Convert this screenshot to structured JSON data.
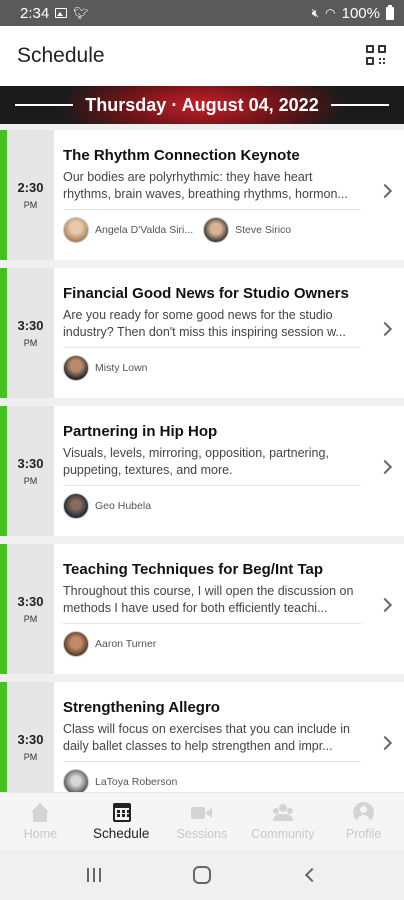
{
  "status_bar": {
    "time": "2:34",
    "battery": "100%"
  },
  "header": {
    "title": "Schedule",
    "qr_icon": "qr-code-icon"
  },
  "date_banner": {
    "text": "Thursday · August 04, 2022"
  },
  "colors": {
    "accent": "#44c21f",
    "banner_red": "#c8202a"
  },
  "sessions": [
    {
      "time": "2:30",
      "ampm": "PM",
      "title": "The Rhythm Connection Keynote",
      "description": "Our bodies are polyrhythmic: they have heart rhythms, brain waves, breathing rhythms, hormon...",
      "speakers": [
        {
          "name": "Angela D'Valda Siri..."
        },
        {
          "name": "Steve Sirico"
        }
      ]
    },
    {
      "time": "3:30",
      "ampm": "PM",
      "title": "Financial Good News for Studio Owners",
      "description": "Are you ready for some good news for the studio industry? Then don't miss this inspiring session w...",
      "speakers": [
        {
          "name": "Misty Lown"
        }
      ]
    },
    {
      "time": "3:30",
      "ampm": "PM",
      "title": "Partnering in Hip Hop",
      "description": "Visuals, levels, mirroring, opposition, partnering, puppeting, textures, and more.",
      "speakers": [
        {
          "name": "Geo Hubela"
        }
      ]
    },
    {
      "time": "3:30",
      "ampm": "PM",
      "title": "Teaching Techniques for Beg/Int Tap",
      "description": "Throughout this course, I will open the discussion on methods I have used for both efficiently teachi...",
      "speakers": [
        {
          "name": "Aaron Turner"
        }
      ]
    },
    {
      "time": "3:30",
      "ampm": "PM",
      "title": "Strengthening Allegro",
      "description": "Class will focus on exercises that you can include in daily ballet classes to help strengthen and impr...",
      "speakers": [
        {
          "name": "LaToya Roberson"
        }
      ]
    }
  ],
  "bottom_nav": [
    {
      "label": "Home",
      "icon": "home-icon",
      "active": false
    },
    {
      "label": "Schedule",
      "icon": "calendar-icon",
      "active": true
    },
    {
      "label": "Sessions",
      "icon": "video-icon",
      "active": false
    },
    {
      "label": "Community",
      "icon": "people-icon",
      "active": false
    },
    {
      "label": "Profile",
      "icon": "profile-icon",
      "active": false
    }
  ]
}
